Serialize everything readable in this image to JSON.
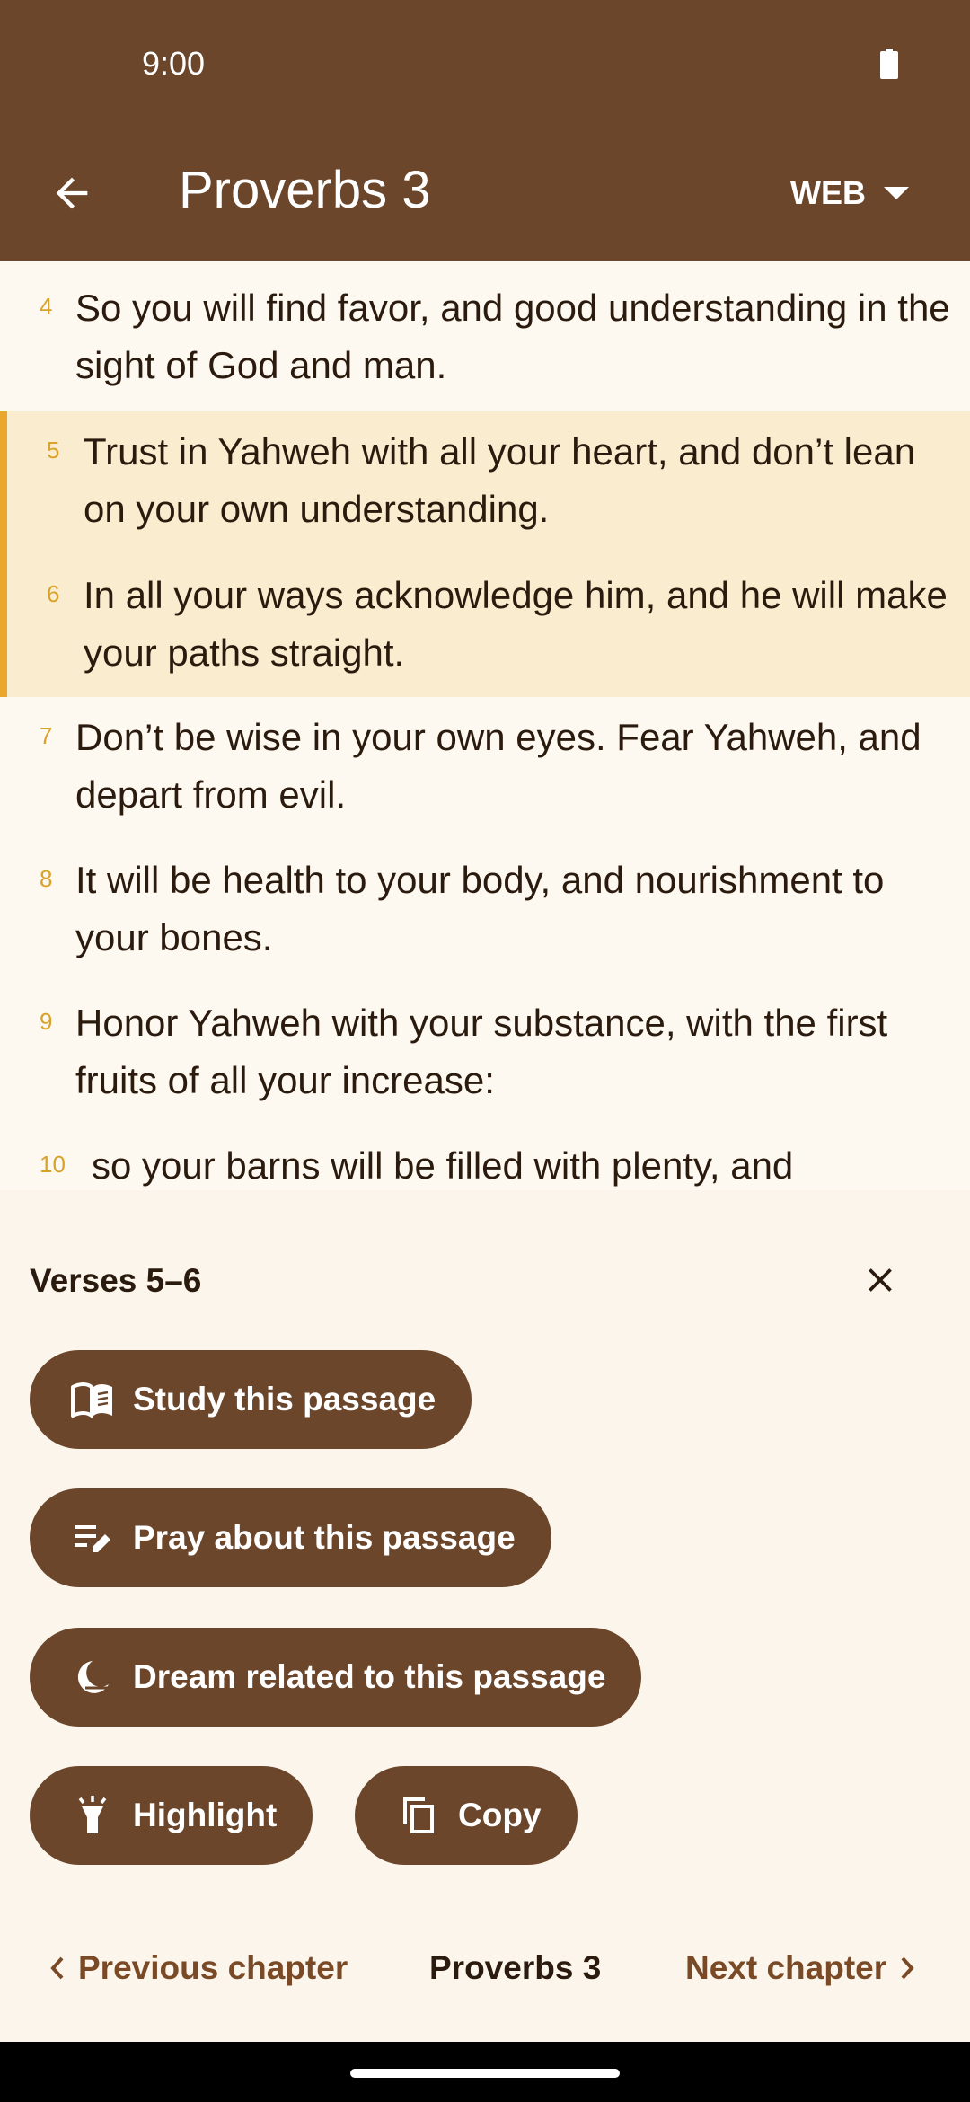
{
  "status_bar": {
    "time": "9:00",
    "battery_icon": "battery-full-icon"
  },
  "app_bar": {
    "back_icon": "arrow-back-icon",
    "title": "Proverbs 3",
    "version": "WEB",
    "dropdown_icon": "caret-down-icon"
  },
  "verses": [
    {
      "num": "4",
      "text": "So you will find favor, and good understanding in the sight of God and man.",
      "selected": false
    },
    {
      "num": "5",
      "text": "Trust in Yahweh with all your heart, and don’t lean on your own understanding.",
      "selected": true
    },
    {
      "num": "6",
      "text": "In all your ways acknowledge him, and he will make your paths straight.",
      "selected": true
    },
    {
      "num": "7",
      "text": "Don’t be wise in your own eyes. Fear Yahweh, and depart from evil.",
      "selected": false
    },
    {
      "num": "8",
      "text": "It will be health to your body, and nourishment to your bones.",
      "selected": false
    },
    {
      "num": "9",
      "text": "Honor Yahweh with your substance, with the first fruits of all your increase:",
      "selected": false
    },
    {
      "num": "10",
      "text": "so your barns will be filled with plenty, and",
      "selected": false
    }
  ],
  "sheet": {
    "title": "Verses 5–6",
    "close_icon": "close-icon",
    "actions": {
      "study": "Study this passage",
      "pray": "Pray about this passage",
      "dream": "Dream related to this passage",
      "highlight": "Highlight",
      "copy": "Copy"
    }
  },
  "chapter_nav": {
    "previous": "Previous chapter",
    "current": "Proverbs 3",
    "next": "Next chapter"
  },
  "colors": {
    "primary_brown": "#6B462B",
    "highlight_fill": "#FAECCF",
    "highlight_bar": "#E9A82C",
    "verse_number": "#D9A22A",
    "background": "#FDF8F0"
  }
}
